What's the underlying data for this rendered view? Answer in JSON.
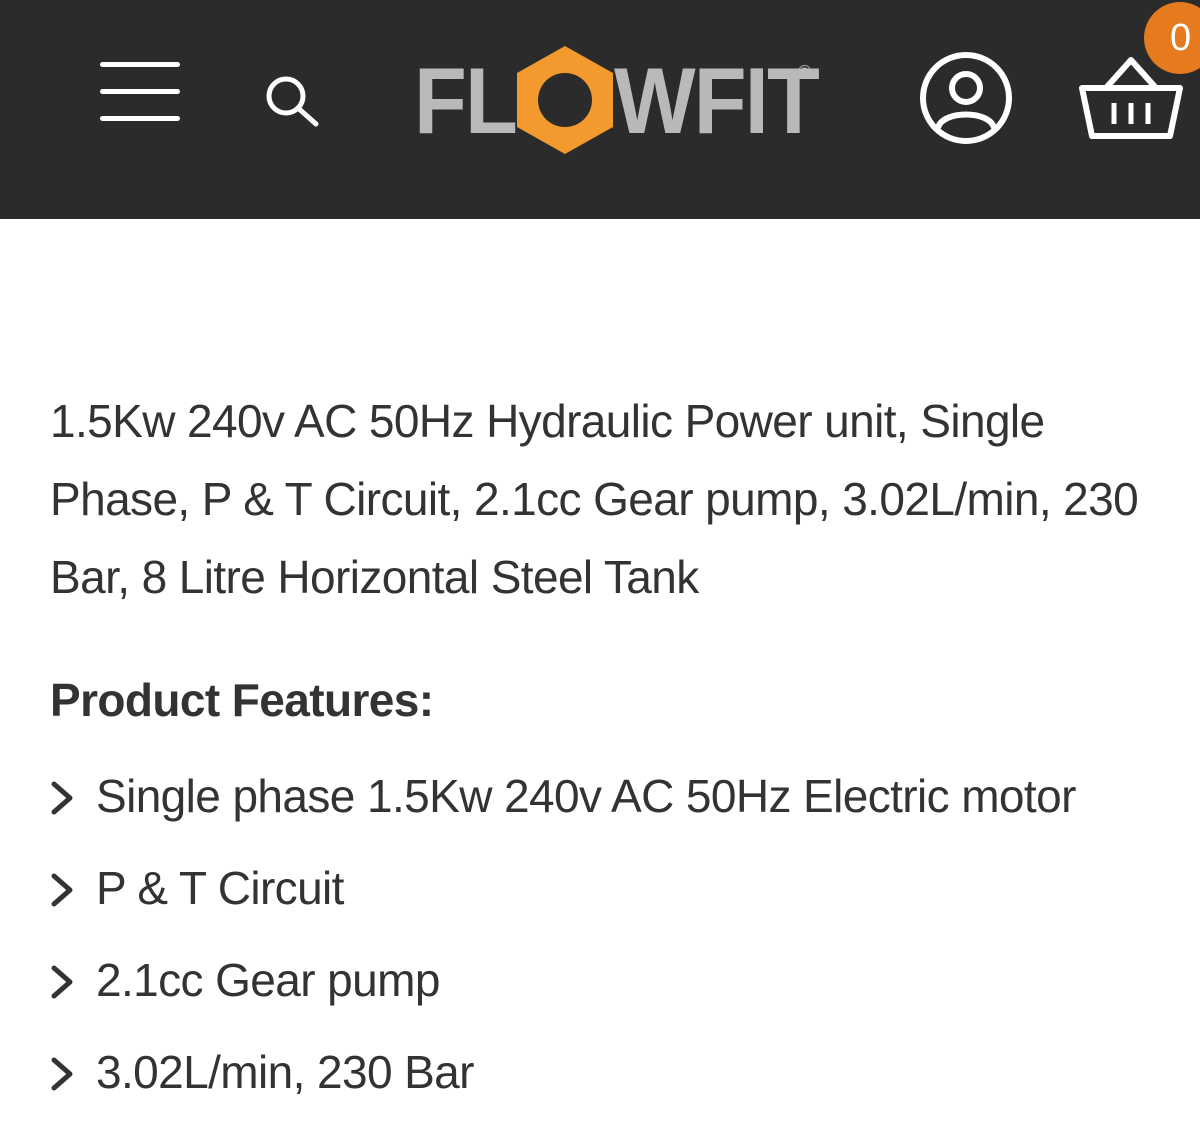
{
  "header": {
    "background": "#2b2b2b",
    "menu_icon": "hamburger-menu-icon",
    "search_icon": "search-icon",
    "logo": {
      "text_before": "FL",
      "text_after": "WFIT",
      "reg_mark": "®",
      "accent_color": "#f29a2e",
      "text_color": "#b9b9b9"
    },
    "account_icon": "user-account-icon",
    "cart_icon": "basket-icon",
    "cart_count": "0",
    "badge_color": "#e57a1f"
  },
  "product": {
    "description": "1.5Kw 240v AC 50Hz Hydraulic Power unit, Single Phase, P & T Circuit, 2.1cc Gear pump, 3.02L/min, 230 Bar, 8 Litre Horizontal Steel Tank",
    "features_title": "Product Features:",
    "features": [
      "Single phase 1.5Kw 240v AC 50Hz Electric motor",
      "P & T Circuit",
      "2.1cc Gear pump",
      "3.02L/min, 230 Bar"
    ],
    "bullet_icon": "chevron-right-icon"
  }
}
